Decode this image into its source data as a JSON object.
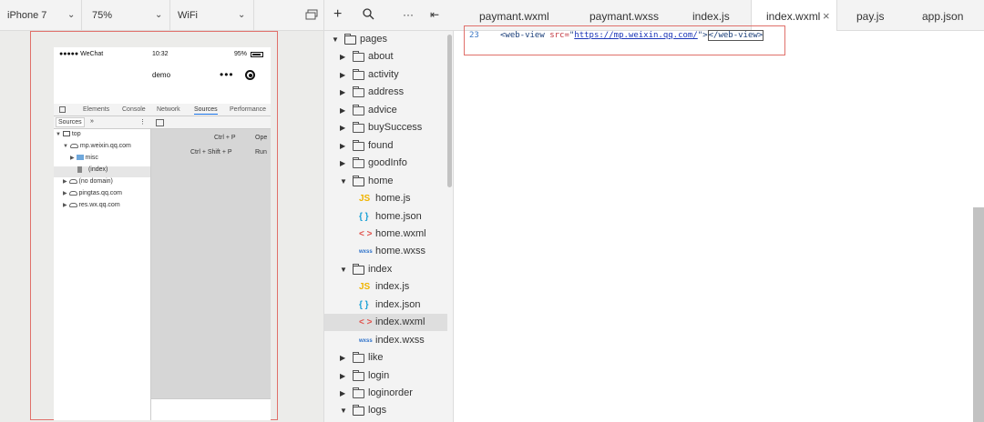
{
  "simulator_toolbar": {
    "device": "iPhone 7",
    "zoom": "75%",
    "network": "WiFi"
  },
  "phone": {
    "carrier": "●●●●● WeChat",
    "time": "10:32",
    "battery": "95%",
    "nav_title": "demo",
    "nav_more": "•••"
  },
  "devtools": {
    "tabs": [
      "Elements",
      "Console",
      "Network",
      "Sources",
      "Performance"
    ],
    "active_tab": "Sources",
    "left_header": "Sources",
    "left_more": "»",
    "left_menu": "⋮",
    "tree": [
      {
        "label": "top",
        "icon": "frame-icon"
      },
      {
        "label": "mp.weixin.qq.com",
        "icon": "cloud-icon"
      },
      {
        "label": "misc",
        "icon": "folder-icon"
      },
      {
        "label": "(index)",
        "icon": "file-icon"
      },
      {
        "label": "(no domain)",
        "icon": "cloud-icon"
      },
      {
        "label": "pingtas.qq.com",
        "icon": "cloud-icon"
      },
      {
        "label": "res.wx.qq.com",
        "icon": "cloud-icon"
      }
    ],
    "shortcuts": [
      {
        "keys": "Ctrl + P",
        "action": "Ope"
      },
      {
        "keys": "Ctrl + Shift + P",
        "action": "Run"
      }
    ]
  },
  "explorer": {
    "toolbar": {
      "add": "+",
      "search": "⚲",
      "more": "···",
      "collapse": "⇤"
    },
    "items": [
      {
        "label": "pages",
        "type": "folder-open"
      },
      {
        "label": "about",
        "type": "folder"
      },
      {
        "label": "activity",
        "type": "folder"
      },
      {
        "label": "address",
        "type": "folder"
      },
      {
        "label": "advice",
        "type": "folder"
      },
      {
        "label": "buySuccess",
        "type": "folder"
      },
      {
        "label": "found",
        "type": "folder"
      },
      {
        "label": "goodInfo",
        "type": "folder"
      },
      {
        "label": "home",
        "type": "folder-open"
      },
      {
        "label": "home.js",
        "type": "js",
        "badge": "JS"
      },
      {
        "label": "home.json",
        "type": "json",
        "badge": "{ }"
      },
      {
        "label": "home.wxml",
        "type": "wxml",
        "badge": "< >"
      },
      {
        "label": "home.wxss",
        "type": "wxss",
        "badge": "wxss"
      },
      {
        "label": "index",
        "type": "folder-open"
      },
      {
        "label": "index.js",
        "type": "js",
        "badge": "JS"
      },
      {
        "label": "index.json",
        "type": "json",
        "badge": "{ }"
      },
      {
        "label": "index.wxml",
        "type": "wxml",
        "badge": "< >"
      },
      {
        "label": "index.wxss",
        "type": "wxss",
        "badge": "wxss"
      },
      {
        "label": "like",
        "type": "folder"
      },
      {
        "label": "login",
        "type": "folder"
      },
      {
        "label": "loginorder",
        "type": "folder"
      },
      {
        "label": "logs",
        "type": "folder-open"
      }
    ]
  },
  "editor": {
    "tabs": [
      "paymant.wxml",
      "paymant.wxss",
      "index.js",
      "index.wxml",
      "pay.js",
      "app.json"
    ],
    "active_tab": "index.wxml",
    "close_glyph": "×",
    "line_number": "23",
    "code": {
      "open_tag": "<web-view ",
      "attr": "src=",
      "quote_open": "\"",
      "url": "https://mp.weixin.qq.com/",
      "quote_close": "\">",
      "close_tag": "</web-view>"
    }
  },
  "colors": {
    "highlight_border": "#e0706a",
    "json_icon": "#1ba1d6",
    "js_icon": "#f0b400",
    "wxml_icon": "#e0504a"
  }
}
